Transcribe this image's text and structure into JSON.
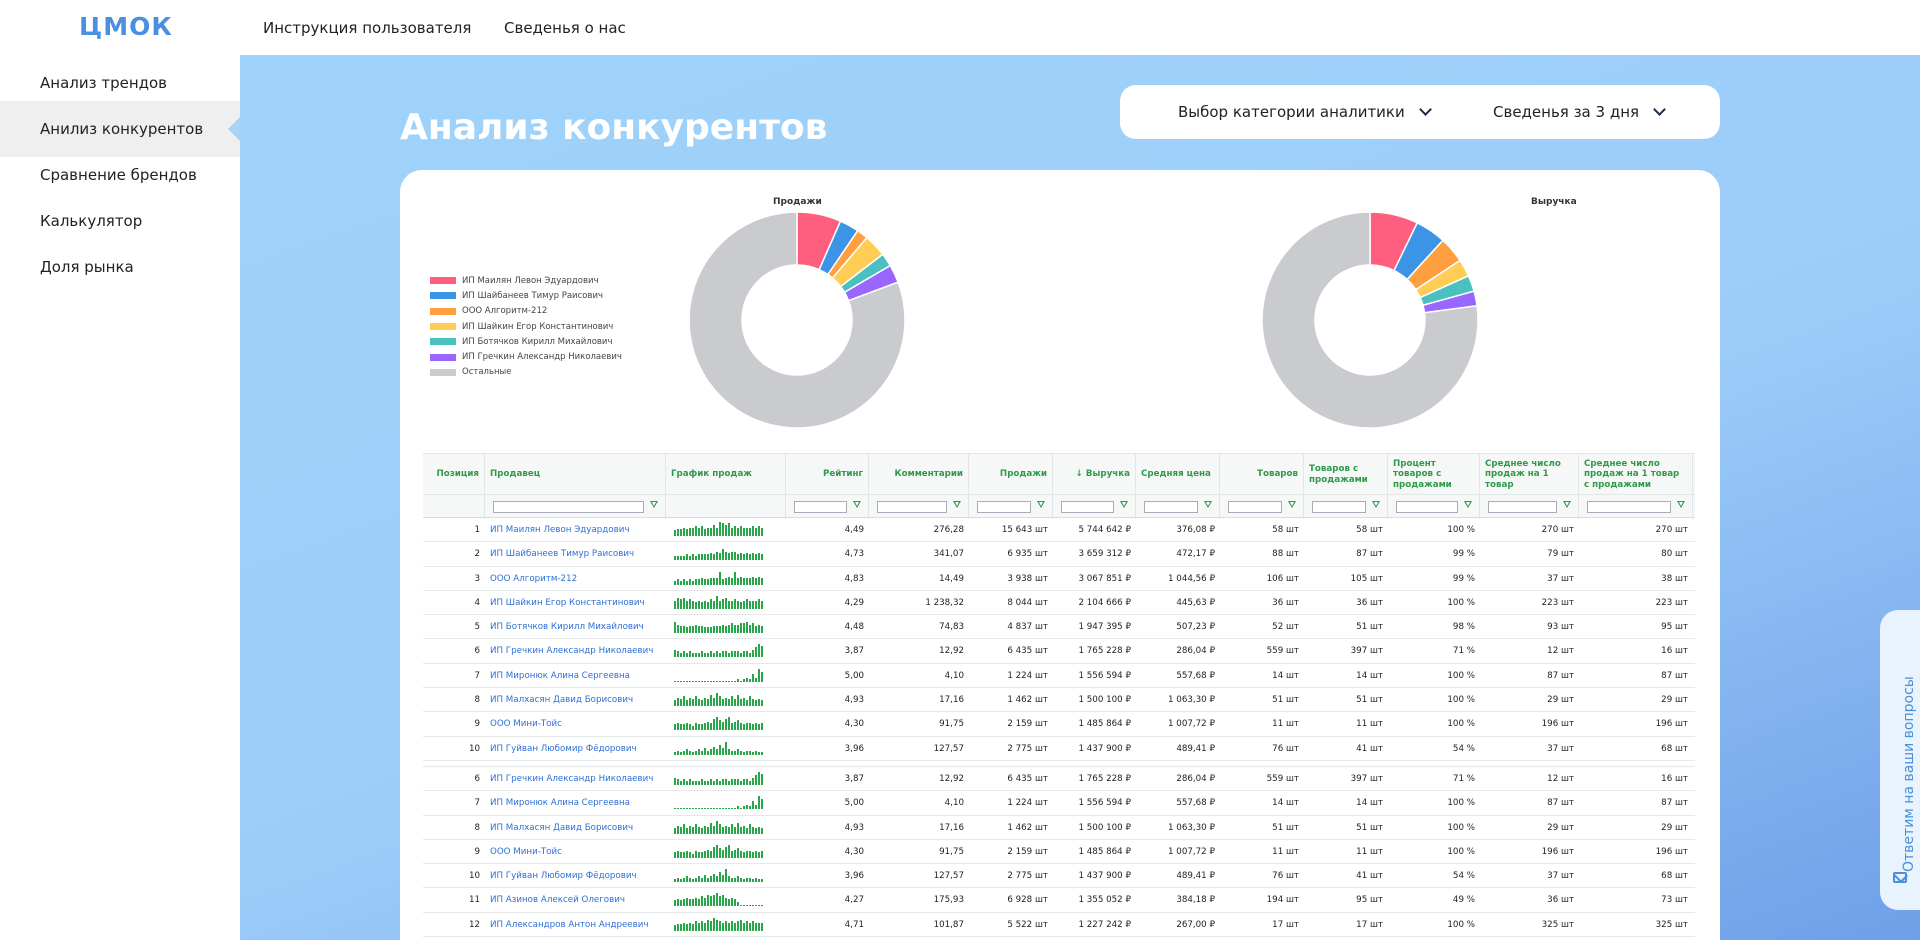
{
  "app": {
    "logo": "ЦМОК"
  },
  "topnav": {
    "instructions": "Инструкция пользователя",
    "about": "Сведенья о нас"
  },
  "sidebar": {
    "items": [
      {
        "label": "Анализ трендов"
      },
      {
        "label": "Анилиз конкурентов",
        "active": true
      },
      {
        "label": "Сравнение брендов"
      },
      {
        "label": "Калькулятор"
      },
      {
        "label": "Доля рынка"
      }
    ]
  },
  "page": {
    "title": "Анализ конкурентов"
  },
  "filters": {
    "category": "Выбор категории аналитики",
    "period": "Сведенья за 3 дня"
  },
  "legend": [
    {
      "label": "ИП Маилян Левон Эдуардович",
      "color": "#ff5f7e"
    },
    {
      "label": "ИП Шайбанеев Тимур Раисович",
      "color": "#3b94e6"
    },
    {
      "label": "ООО Алгоритм-212",
      "color": "#ff9f40"
    },
    {
      "label": "ИП Шайкин Егор Константинович",
      "color": "#ffcd56"
    },
    {
      "label": "ИП Ботячков Кирилл Михайлович",
      "color": "#4bc0c0"
    },
    {
      "label": "ИП Гречкин Александр Николаевич",
      "color": "#9966ff"
    },
    {
      "label": "Остальные",
      "color": "#c9cbcf"
    }
  ],
  "chart_data": [
    {
      "type": "pie",
      "title": "Продажи",
      "categories": [
        "ИП Маилян Левон Эдуардович",
        "ИП Шайбанеев Тимур Раисович",
        "ООО Алгоритм-212",
        "ИП Шайкин Егор Константинович",
        "ИП Ботячков Кирилл Михайлович",
        "ИП Гречкин Александр Николаевич",
        "Остальные"
      ],
      "values": [
        6.6,
        2.9,
        1.7,
        3.4,
        2.0,
        2.7,
        80.7
      ],
      "hole": true
    },
    {
      "type": "pie",
      "title": "Выручка",
      "categories": [
        "ИП Маилян Левон Эдуардович",
        "ИП Шайбанеев Тимур Раисович",
        "ООО Алгоритм-212",
        "ИП Шайкин Егор Константинович",
        "ИП Ботячков Кирилл Михайлович",
        "ИП Гречкин Александр Николаевич",
        "Остальные"
      ],
      "values": [
        7.2,
        4.6,
        3.9,
        2.6,
        2.4,
        2.2,
        77.1
      ],
      "hole": true
    }
  ],
  "table": {
    "columns": [
      {
        "label": "Позиция"
      },
      {
        "label": "Продавец"
      },
      {
        "label": "График продаж"
      },
      {
        "label": "Рейтинг"
      },
      {
        "label": "Комментарии"
      },
      {
        "label": "Продажи"
      },
      {
        "label": "↓ Выручка"
      },
      {
        "label": "Средняя цена"
      },
      {
        "label": "Товаров"
      },
      {
        "label": "Товаров с продажами"
      },
      {
        "label": "Процент товаров с продажами"
      },
      {
        "label": "Среднее число продаж на 1 товар"
      },
      {
        "label": "Среднее число продаж на 1 товар с продажами"
      }
    ],
    "rows_top": [
      {
        "pos": "1",
        "seller": "ИП Маилян Левон Эдуардович",
        "rating": "4,49",
        "comments": "276,28",
        "sales": "15 643 шт",
        "revenue": "5 744 642 ₽",
        "price": "376,08 ₽",
        "items": "58 шт",
        "items_sold": "58 шт",
        "percent": "100 %",
        "avg": "270 шт",
        "avg_sold": "270 шт",
        "spark": [
          0.4,
          0.5,
          0.5,
          0.6,
          0.5,
          0.6,
          0.6,
          0.7,
          0.6,
          0.7,
          0.5,
          0.6,
          0.6,
          0.8,
          0.6,
          1.0,
          0.9,
          0.8,
          0.9,
          0.6,
          0.7,
          0.6,
          0.7,
          0.6,
          0.6,
          0.6,
          0.7,
          0.6,
          0.7,
          0.6
        ]
      },
      {
        "pos": "2",
        "seller": "ИП Шайбанеев Тимур Раисович",
        "rating": "4,73",
        "comments": "341,07",
        "sales": "6 935 шт",
        "revenue": "3 659 312 ₽",
        "price": "472,17 ₽",
        "items": "88 шт",
        "items_sold": "87 шт",
        "percent": "99 %",
        "avg": "79 шт",
        "avg_sold": "80 шт",
        "spark": [
          0.3,
          0.3,
          0.3,
          0.3,
          0.4,
          0.3,
          0.4,
          0.3,
          0.4,
          0.4,
          0.4,
          0.4,
          0.5,
          0.4,
          0.6,
          0.5,
          0.8,
          0.6,
          0.5,
          0.6,
          0.6,
          0.4,
          0.5,
          0.4,
          0.5,
          0.4,
          0.5,
          0.4,
          0.5,
          0.4
        ]
      },
      {
        "pos": "3",
        "seller": "ООО Алгоритм-212",
        "rating": "4,83",
        "comments": "14,49",
        "sales": "3 938 шт",
        "revenue": "3 067 851 ₽",
        "price": "1 044,56 ₽",
        "items": "106 шт",
        "items_sold": "105 шт",
        "percent": "99 %",
        "avg": "37 шт",
        "avg_sold": "38 шт",
        "spark": [
          0.3,
          0.4,
          0.3,
          0.4,
          0.3,
          0.4,
          0.3,
          0.4,
          0.4,
          0.5,
          0.4,
          0.4,
          0.5,
          0.5,
          0.5,
          0.9,
          0.4,
          0.5,
          0.6,
          0.5,
          0.9,
          0.5,
          0.6,
          0.5,
          0.5,
          0.5,
          0.6,
          0.5,
          0.6,
          0.5
        ]
      },
      {
        "pos": "4",
        "seller": "ИП Шайкин Егор Константинович",
        "rating": "4,29",
        "comments": "1 238,32",
        "sales": "8 044 шт",
        "revenue": "2 104 666 ₽",
        "price": "445,63 ₽",
        "items": "36 шт",
        "items_sold": "36 шт",
        "percent": "100 %",
        "avg": "223 шт",
        "avg_sold": "223 шт",
        "spark": [
          0.6,
          0.8,
          0.7,
          0.8,
          0.6,
          0.7,
          0.6,
          0.5,
          0.6,
          0.5,
          0.6,
          0.5,
          0.7,
          0.6,
          0.9,
          0.6,
          0.7,
          0.8,
          0.6,
          0.6,
          0.7,
          0.6,
          0.5,
          0.6,
          0.7,
          0.6,
          0.6,
          0.6,
          0.7,
          0.6
        ]
      },
      {
        "pos": "5",
        "seller": "ИП Ботячков Кирилл Михайлович",
        "rating": "4,48",
        "comments": "74,83",
        "sales": "4 837 шт",
        "revenue": "1 947 395 ₽",
        "price": "507,23 ₽",
        "items": "52 шт",
        "items_sold": "51 шт",
        "percent": "98 %",
        "avg": "93 шт",
        "avg_sold": "95 шт",
        "spark": [
          0.8,
          0.6,
          0.5,
          0.5,
          0.4,
          0.5,
          0.5,
          0.6,
          0.5,
          0.5,
          0.4,
          0.4,
          0.4,
          0.5,
          0.5,
          0.5,
          0.6,
          0.5,
          0.6,
          0.7,
          0.6,
          0.6,
          0.7,
          0.7,
          0.8,
          0.6,
          0.7,
          0.5,
          0.6,
          0.5
        ]
      },
      {
        "pos": "6",
        "seller": "ИП Гречкин Александр Николаевич",
        "rating": "3,87",
        "comments": "12,92",
        "sales": "6 435 шт",
        "revenue": "1 765 228 ₽",
        "price": "286,04 ₽",
        "items": "559 шт",
        "items_sold": "397 шт",
        "percent": "71 %",
        "avg": "12 шт",
        "avg_sold": "16 шт",
        "spark": [
          0.5,
          0.4,
          0.3,
          0.4,
          0.3,
          0.4,
          0.3,
          0.3,
          0.3,
          0.4,
          0.3,
          0.3,
          0.4,
          0.3,
          0.4,
          0.3,
          0.4,
          0.4,
          0.3,
          0.4,
          0.4,
          0.4,
          0.3,
          0.4,
          0.4,
          0.3,
          0.5,
          0.7,
          0.9,
          0.8
        ]
      },
      {
        "pos": "7",
        "seller": "ИП Миронюк Алина Сергеевна",
        "rating": "5,00",
        "comments": "4,10",
        "sales": "1 224 шт",
        "revenue": "1 556 594 ₽",
        "price": "557,68 ₽",
        "items": "14 шт",
        "items_sold": "14 шт",
        "percent": "100 %",
        "avg": "87 шт",
        "avg_sold": "87 шт",
        "spark": [
          0.05,
          0.05,
          0.05,
          0.05,
          0.05,
          0.05,
          0.05,
          0.05,
          0.05,
          0.05,
          0.05,
          0.05,
          0.05,
          0.05,
          0.05,
          0.05,
          0.05,
          0.05,
          0.05,
          0.05,
          0.1,
          0.2,
          0.1,
          0.2,
          0.3,
          0.2,
          0.6,
          0.3,
          0.9,
          0.7
        ]
      },
      {
        "pos": "8",
        "seller": "ИП Малхасян Давид Борисович",
        "rating": "4,93",
        "comments": "17,16",
        "sales": "1 462 шт",
        "revenue": "1 500 100 ₽",
        "price": "1 063,30 ₽",
        "items": "51 шт",
        "items_sold": "51 шт",
        "percent": "100 %",
        "avg": "29 шт",
        "avg_sold": "29 шт",
        "spark": [
          0.4,
          0.6,
          0.5,
          0.7,
          0.4,
          0.6,
          0.5,
          0.7,
          0.5,
          0.4,
          0.6,
          0.5,
          0.8,
          0.6,
          0.9,
          0.7,
          0.5,
          0.6,
          0.5,
          0.7,
          0.5,
          0.8,
          0.5,
          0.6,
          0.4,
          0.7,
          0.5,
          0.4,
          0.5,
          0.4
        ]
      },
      {
        "pos": "9",
        "seller": "ООО Мини-Тойс",
        "rating": "4,30",
        "comments": "91,75",
        "sales": "2 159 шт",
        "revenue": "1 485 864 ₽",
        "price": "1 007,72 ₽",
        "items": "11 шт",
        "items_sold": "11 шт",
        "percent": "100 %",
        "avg": "196 шт",
        "avg_sold": "196 шт",
        "spark": [
          0.4,
          0.5,
          0.4,
          0.4,
          0.5,
          0.4,
          0.3,
          0.5,
          0.4,
          0.4,
          0.5,
          0.6,
          0.5,
          0.8,
          0.9,
          0.7,
          0.6,
          0.8,
          0.9,
          0.5,
          0.6,
          0.7,
          0.5,
          0.4,
          0.5,
          0.5,
          0.4,
          0.5,
          0.4,
          0.5
        ]
      },
      {
        "pos": "10",
        "seller": "ИП Гуйван Любомир Фёдорович",
        "rating": "3,96",
        "comments": "127,57",
        "sales": "2 775 шт",
        "revenue": "1 437 900 ₽",
        "price": "489,41 ₽",
        "items": "76 шт",
        "items_sold": "41 шт",
        "percent": "54 %",
        "avg": "37 шт",
        "avg_sold": "68 шт",
        "spark": [
          0.2,
          0.3,
          0.2,
          0.3,
          0.4,
          0.3,
          0.2,
          0.3,
          0.4,
          0.3,
          0.5,
          0.3,
          0.4,
          0.6,
          0.4,
          0.7,
          0.5,
          0.9,
          0.4,
          0.3,
          0.3,
          0.4,
          0.3,
          0.2,
          0.3,
          0.3,
          0.2,
          0.3,
          0.2,
          0.2
        ]
      }
    ],
    "rows_bottom": [
      {
        "pos": "6",
        "seller": "ИП Гречкин Александр Николаевич",
        "rating": "3,87",
        "comments": "12,92",
        "sales": "6 435 шт",
        "revenue": "1 765 228 ₽",
        "price": "286,04 ₽",
        "items": "559 шт",
        "items_sold": "397 шт",
        "percent": "71 %",
        "avg": "12 шт",
        "avg_sold": "16 шт",
        "spark": [
          0.5,
          0.4,
          0.3,
          0.4,
          0.3,
          0.4,
          0.3,
          0.3,
          0.3,
          0.4,
          0.3,
          0.3,
          0.4,
          0.3,
          0.4,
          0.3,
          0.4,
          0.4,
          0.3,
          0.4,
          0.4,
          0.4,
          0.3,
          0.4,
          0.4,
          0.3,
          0.5,
          0.7,
          0.9,
          0.8
        ]
      },
      {
        "pos": "7",
        "seller": "ИП Миронюк Алина Сергеевна",
        "rating": "5,00",
        "comments": "4,10",
        "sales": "1 224 шт",
        "revenue": "1 556 594 ₽",
        "price": "557,68 ₽",
        "items": "14 шт",
        "items_sold": "14 шт",
        "percent": "100 %",
        "avg": "87 шт",
        "avg_sold": "87 шт",
        "spark": [
          0.05,
          0.05,
          0.05,
          0.05,
          0.05,
          0.05,
          0.05,
          0.05,
          0.05,
          0.05,
          0.05,
          0.05,
          0.05,
          0.05,
          0.05,
          0.05,
          0.05,
          0.05,
          0.05,
          0.05,
          0.1,
          0.2,
          0.1,
          0.2,
          0.3,
          0.2,
          0.6,
          0.3,
          0.9,
          0.7
        ]
      },
      {
        "pos": "8",
        "seller": "ИП Малхасян Давид Борисович",
        "rating": "4,93",
        "comments": "17,16",
        "sales": "1 462 шт",
        "revenue": "1 500 100 ₽",
        "price": "1 063,30 ₽",
        "items": "51 шт",
        "items_sold": "51 шт",
        "percent": "100 %",
        "avg": "29 шт",
        "avg_sold": "29 шт",
        "spark": [
          0.4,
          0.6,
          0.5,
          0.7,
          0.4,
          0.6,
          0.5,
          0.7,
          0.5,
          0.4,
          0.6,
          0.5,
          0.8,
          0.6,
          0.9,
          0.7,
          0.5,
          0.6,
          0.5,
          0.7,
          0.5,
          0.8,
          0.5,
          0.6,
          0.4,
          0.7,
          0.5,
          0.4,
          0.5,
          0.4
        ]
      },
      {
        "pos": "9",
        "seller": "ООО Мини-Тойс",
        "rating": "4,30",
        "comments": "91,75",
        "sales": "2 159 шт",
        "revenue": "1 485 864 ₽",
        "price": "1 007,72 ₽",
        "items": "11 шт",
        "items_sold": "11 шт",
        "percent": "100 %",
        "avg": "196 шт",
        "avg_sold": "196 шт",
        "spark": [
          0.4,
          0.5,
          0.4,
          0.4,
          0.5,
          0.4,
          0.3,
          0.5,
          0.4,
          0.4,
          0.5,
          0.6,
          0.5,
          0.8,
          0.9,
          0.7,
          0.6,
          0.8,
          0.9,
          0.5,
          0.6,
          0.7,
          0.5,
          0.4,
          0.5,
          0.5,
          0.4,
          0.5,
          0.4,
          0.5
        ]
      },
      {
        "pos": "10",
        "seller": "ИП Гуйван Любомир Фёдорович",
        "rating": "3,96",
        "comments": "127,57",
        "sales": "2 775 шт",
        "revenue": "1 437 900 ₽",
        "price": "489,41 ₽",
        "items": "76 шт",
        "items_sold": "41 шт",
        "percent": "54 %",
        "avg": "37 шт",
        "avg_sold": "68 шт",
        "spark": [
          0.2,
          0.3,
          0.2,
          0.3,
          0.4,
          0.3,
          0.2,
          0.3,
          0.4,
          0.3,
          0.5,
          0.3,
          0.4,
          0.6,
          0.4,
          0.7,
          0.5,
          0.9,
          0.4,
          0.3,
          0.3,
          0.4,
          0.3,
          0.2,
          0.3,
          0.3,
          0.2,
          0.3,
          0.2,
          0.2
        ]
      },
      {
        "pos": "11",
        "seller": "ИП Азинов Алексей Олегович",
        "rating": "4,27",
        "comments": "175,93",
        "sales": "6 928 шт",
        "revenue": "1 355 052 ₽",
        "price": "384,18 ₽",
        "items": "194 шт",
        "items_sold": "95 шт",
        "percent": "49 %",
        "avg": "36 шт",
        "avg_sold": "73 шт",
        "spark": [
          0.4,
          0.5,
          0.4,
          0.5,
          0.6,
          0.5,
          0.5,
          0.6,
          0.5,
          0.7,
          0.6,
          0.8,
          0.7,
          0.8,
          0.9,
          0.7,
          0.8,
          0.6,
          0.5,
          0.6,
          0.5,
          0.3,
          0.05,
          0.05,
          0.05,
          0.05,
          0.05,
          0.05,
          0.05,
          0.05
        ]
      },
      {
        "pos": "12",
        "seller": "ИП Александров Антон Андреевич",
        "rating": "4,71",
        "comments": "101,87",
        "sales": "5 522 шт",
        "revenue": "1 227 242 ₽",
        "price": "267,00 ₽",
        "items": "17 шт",
        "items_sold": "17 шт",
        "percent": "100 %",
        "avg": "325 шт",
        "avg_sold": "325 шт",
        "spark": [
          0.4,
          0.5,
          0.5,
          0.6,
          0.5,
          0.6,
          0.5,
          0.7,
          0.6,
          0.7,
          0.6,
          0.8,
          0.7,
          0.9,
          0.8,
          0.7,
          0.6,
          0.7,
          0.6,
          0.7,
          0.6,
          0.7,
          0.8,
          0.6,
          0.7,
          0.6,
          0.7,
          0.6,
          0.6,
          0.6
        ]
      }
    ]
  },
  "feedback": {
    "label": "Ответим на ваши вопросы"
  }
}
